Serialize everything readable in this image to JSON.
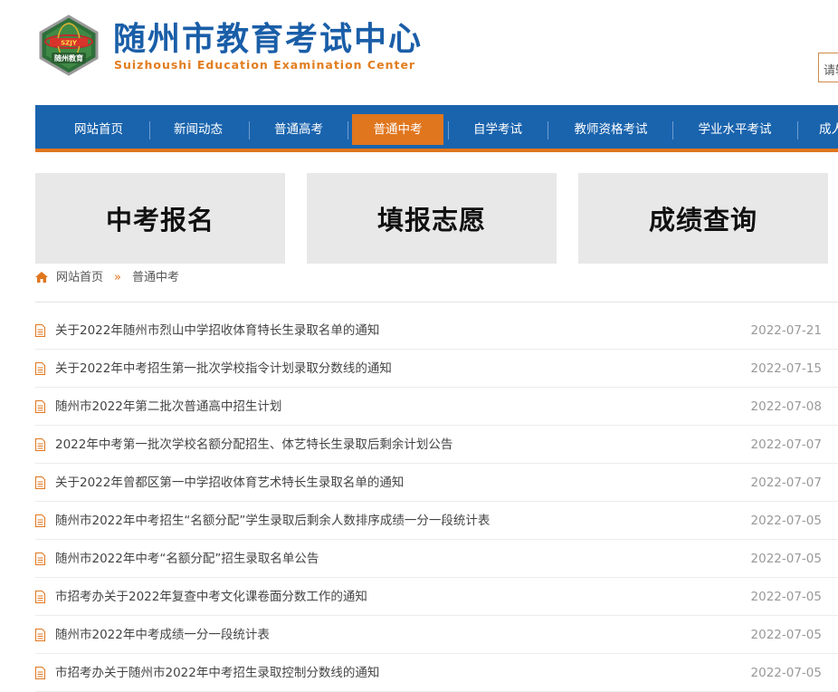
{
  "header": {
    "logo_icon": "exam-center-emblem-icon",
    "title": "随州市教育考试中心",
    "subtitle": "Suizhoushi Education Examination Center",
    "search_placeholder": "请输入关键字"
  },
  "nav": {
    "items": [
      {
        "label": "网站首页"
      },
      {
        "label": "新闻动态"
      },
      {
        "label": "普通高考"
      },
      {
        "label": "普通中考",
        "active": true
      },
      {
        "label": "自学考试"
      },
      {
        "label": "教师资格考试"
      },
      {
        "label": "学业水平考试"
      },
      {
        "label": "成人高考"
      }
    ],
    "colors": {
      "background": "#1a64ae",
      "active": "#e0761e"
    }
  },
  "tiles": [
    {
      "label": "中考报名"
    },
    {
      "label": "填报志愿"
    },
    {
      "label": "成绩查询"
    }
  ],
  "breadcrumb": {
    "home_icon": "home-icon",
    "home": "网站首页",
    "separator": "»",
    "current": "普通中考"
  },
  "news": [
    {
      "title": "关于2022年随州市烈山中学招收体育特长生录取名单的通知",
      "date": "2022-07-21"
    },
    {
      "title": "关于2022年中考招生第一批次学校指令计划录取分数线的通知",
      "date": "2022-07-15"
    },
    {
      "title": "随州市2022年第二批次普通高中招生计划",
      "date": "2022-07-08"
    },
    {
      "title": "2022年中考第一批次学校名额分配招生、体艺特长生录取后剩余计划公告",
      "date": "2022-07-07"
    },
    {
      "title": "关于2022年曾都区第一中学招收体育艺术特长生录取名单的通知",
      "date": "2022-07-07"
    },
    {
      "title": "随州市2022年中考招生“名额分配”学生录取后剩余人数排序成绩一分一段统计表",
      "date": "2022-07-05"
    },
    {
      "title": "随州市2022年中考“名额分配”招生录取名单公告",
      "date": "2022-07-05"
    },
    {
      "title": "市招考办关于2022年复查中考文化课卷面分数工作的通知",
      "date": "2022-07-05"
    },
    {
      "title": "随州市2022年中考成绩一分一段统计表",
      "date": "2022-07-05"
    },
    {
      "title": "市招考办关于随州市2022年中考招生录取控制分数线的通知",
      "date": "2022-07-05"
    }
  ],
  "news_icon": "document-icon"
}
